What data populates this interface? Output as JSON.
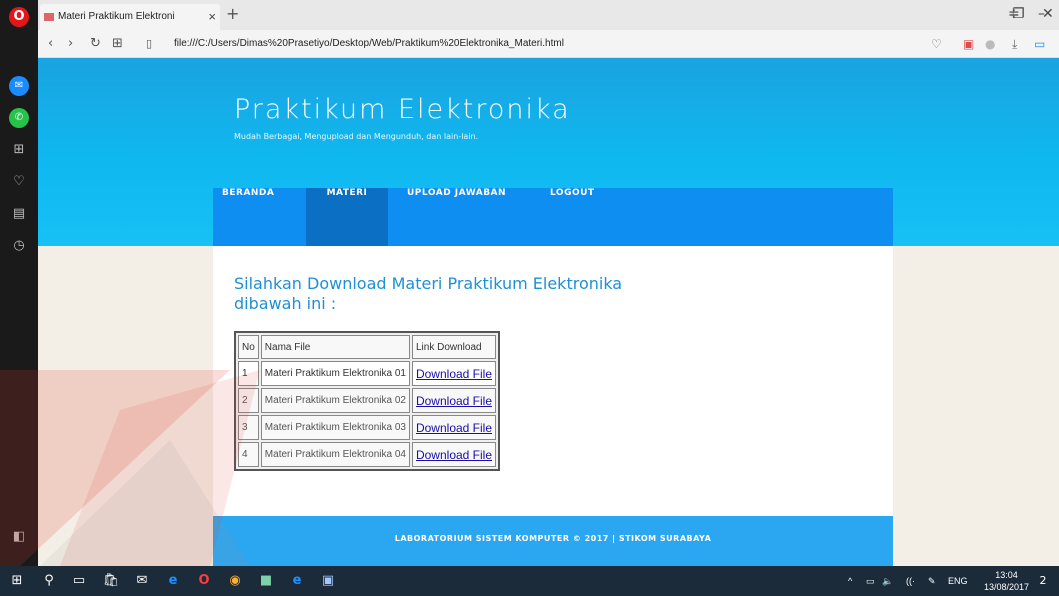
{
  "browser": {
    "tab_title": "Materi Praktikum Elektroni",
    "new_tab": "+",
    "url": "file:///C:/Users/Dimas%20Prasetiyo/Desktop/Web/Praktikum%20Elektronika_Materi.html"
  },
  "site": {
    "title": "Praktikum Elektronika",
    "subtitle": "Mudah Berbagai, Mengupload dan Mengunduh, dan lain-lain.",
    "nav": [
      "BERANDA",
      "MATERI",
      "UPLOAD JAWABAN",
      "LOGOUT"
    ],
    "active_nav": "MATERI",
    "heading": "Silahkan Download Materi Praktikum Elektronika dibawah ini :",
    "table": {
      "headers": [
        "No",
        "Nama File",
        "Link Download"
      ],
      "rows": [
        {
          "no": "1",
          "name": "Materi Praktikum Elektronika 01",
          "link": "Download File"
        },
        {
          "no": "2",
          "name": "Materi Praktikum Elektronika 02",
          "link": "Download File"
        },
        {
          "no": "3",
          "name": "Materi Praktikum Elektronika 03",
          "link": "Download File"
        },
        {
          "no": "4",
          "name": "Materi Praktikum Elektronika 04",
          "link": "Download File"
        }
      ]
    },
    "footer": "LABORATORIUM SISTEM KOMPUTER © 2017 | STIKOM SURABAYA"
  },
  "taskbar": {
    "lang": "ENG",
    "time": "13:04",
    "date": "13/08/2017",
    "notification_count": "2"
  },
  "colors": {
    "hero": "#17b6ee",
    "navbar": "#0d8ef0",
    "nav_active": "#0b6fc4",
    "footer": "#2ba6f0",
    "heading": "#1e90d6"
  }
}
